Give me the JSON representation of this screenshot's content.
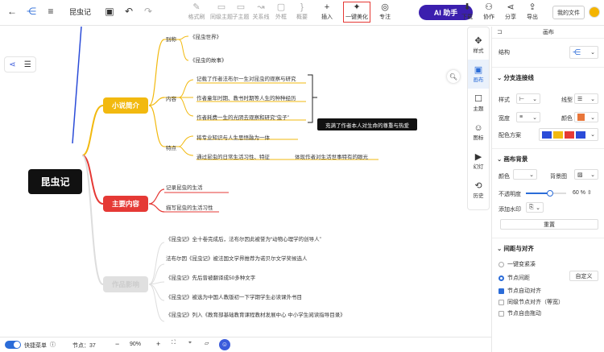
{
  "toolbar": {
    "title": "昆虫记",
    "buttons": [
      {
        "label": "格式刷",
        "glyph": "✎",
        "active": false
      },
      {
        "label": "同级主题",
        "glyph": "▭",
        "active": false
      },
      {
        "label": "子主题",
        "glyph": "▭",
        "active": false
      },
      {
        "label": "关系线",
        "glyph": "↝",
        "active": false
      },
      {
        "label": "外框",
        "glyph": "▢",
        "active": false
      },
      {
        "label": "概要",
        "glyph": "}",
        "active": false
      },
      {
        "label": "插入",
        "glyph": "+",
        "active": true
      },
      {
        "label": "一键美化",
        "glyph": "✦",
        "active": true
      },
      {
        "label": "专注",
        "glyph": "◎",
        "active": true
      }
    ],
    "ai_label": "AI 助手",
    "right_buttons": [
      {
        "label": "下载",
        "glyph": "⬇"
      },
      {
        "label": "协作",
        "glyph": "⚇"
      },
      {
        "label": "分享",
        "glyph": "⋖"
      },
      {
        "label": "导出",
        "glyph": "⇪"
      }
    ],
    "my_files": "我的文件"
  },
  "mindmap": {
    "root": "昆虫记",
    "branches": [
      {
        "label": "小说简介",
        "color": "#f2b90f"
      },
      {
        "label": "主要内容",
        "color": "#e53935"
      },
      {
        "label": "作品影响",
        "color": "#e0e0e0"
      }
    ],
    "intro": {
      "alias_label": "别称",
      "aliases": [
        "《昆虫世界》",
        "《昆虫的故事》"
      ],
      "content_label": "内容",
      "contents": [
        "记载了作者法布尔一生对昆虫的观察与研究",
        "作者童年时期、教书时期等人生的种种经历",
        "作者耗费一生的光阴去观察和研究“虫子”"
      ],
      "summary": "充满了作者本人对生命的尊重与热爱",
      "feature_label": "特点",
      "features": [
        "将专业知识与人生思悟融为一体",
        "通过昆虫的日常生活习性、特征",
        "体现作者对生活世事特有的眼光"
      ]
    },
    "main": [
      "记录昆虫的生活",
      "描写昆虫的生活习性"
    ],
    "impact": [
      "《昆虫记》全十卷完成后，法布尔因此被誉为“动物心理学的创导人”",
      "法布尔因《昆虫记》被法国文学界推荐为诺贝尔文学奖候选人",
      "《昆虫记》先后曾被翻译成50多种文字",
      "《昆虫记》被选为中国人教版初一下学期学生必读课外书目",
      "《昆虫记》列入《教育部基础教育课程教材发展中心 中小学生阅读指导目录》"
    ]
  },
  "sidetabs": [
    {
      "label": "样式",
      "glyph": "✥"
    },
    {
      "label": "画布",
      "glyph": "▣"
    },
    {
      "label": "主题",
      "glyph": "☐"
    },
    {
      "label": "图标",
      "glyph": "☺"
    },
    {
      "label": "幻灯",
      "glyph": "▶"
    },
    {
      "label": "历史",
      "glyph": "⟲"
    }
  ],
  "panel": {
    "header": "画布",
    "structure_label": "结构",
    "branch_section": "分支连接线",
    "style_label": "样式",
    "line_type_label": "线型",
    "width_label": "宽度",
    "color_label": "颜色",
    "scheme_label": "配色方案",
    "line_color": "#e8763a",
    "scheme_colors": [
      "#2b4cd8",
      "#f2b90f",
      "#e53935",
      "#2b4cd8"
    ],
    "background_section": "画布背景",
    "bg_color_label": "颜色",
    "bg_image_label": "背景图",
    "opacity_label": "不透明度",
    "opacity_value": "60",
    "opacity_unit": "%",
    "opacity_fraction": 0.6,
    "watermark_label": "添加水印",
    "reset_label": "重置",
    "spacing_section": "间距与对齐",
    "spacing_options": [
      {
        "label": "一键变紧凑",
        "checked": false
      },
      {
        "label": "节点间距",
        "checked": true
      }
    ],
    "custom_label": "自定义",
    "align_options": [
      {
        "label": "节点自动对齐",
        "checked": true
      },
      {
        "label": "同级节点对齐（等宽）",
        "checked": false
      },
      {
        "label": "节点自由拖动",
        "checked": false
      }
    ]
  },
  "status": {
    "quick_menu": "快捷菜单",
    "node_count_label": "节点：",
    "node_count": "37",
    "zoom": "90%"
  }
}
